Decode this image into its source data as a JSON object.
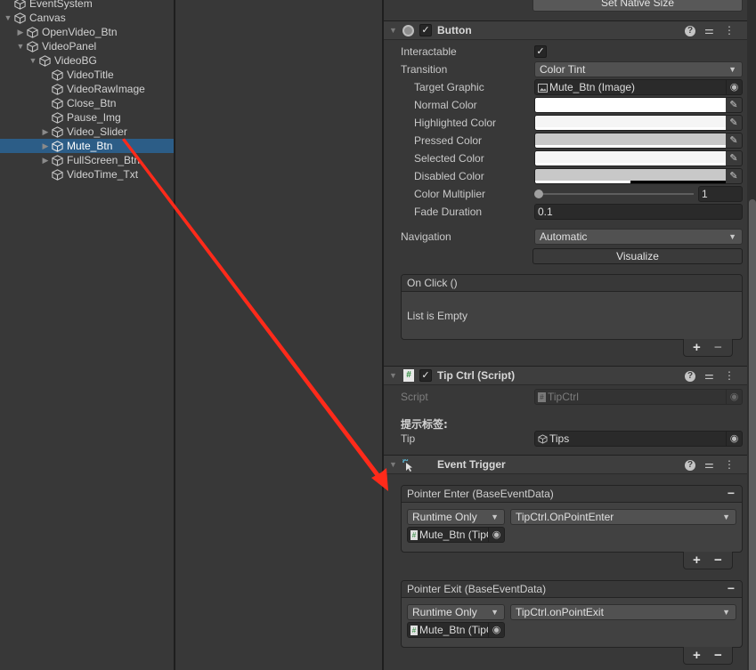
{
  "hierarchy": {
    "items": [
      {
        "label": "EventSystem",
        "depth": 0,
        "foldout": "none",
        "selected": false
      },
      {
        "label": "Canvas",
        "depth": 0,
        "foldout": "expanded",
        "selected": false
      },
      {
        "label": "OpenVideo_Btn",
        "depth": 1,
        "foldout": "collapsed",
        "selected": false
      },
      {
        "label": "VideoPanel",
        "depth": 1,
        "foldout": "expanded",
        "selected": false
      },
      {
        "label": "VideoBG",
        "depth": 2,
        "foldout": "expanded",
        "selected": false
      },
      {
        "label": "VideoTitle",
        "depth": 3,
        "foldout": "none",
        "selected": false
      },
      {
        "label": "VideoRawImage",
        "depth": 3,
        "foldout": "none",
        "selected": false
      },
      {
        "label": "Close_Btn",
        "depth": 3,
        "foldout": "none",
        "selected": false
      },
      {
        "label": "Pause_Img",
        "depth": 3,
        "foldout": "none",
        "selected": false
      },
      {
        "label": "Video_Slider",
        "depth": 3,
        "foldout": "collapsed",
        "selected": false
      },
      {
        "label": "Mute_Btn",
        "depth": 3,
        "foldout": "collapsed",
        "selected": true
      },
      {
        "label": "FullScreen_Btn",
        "depth": 3,
        "foldout": "collapsed",
        "selected": false
      },
      {
        "label": "VideoTime_Txt",
        "depth": 3,
        "foldout": "none",
        "selected": false
      }
    ]
  },
  "inspector": {
    "set_native_size_label": "Set Native Size",
    "button_component": {
      "title": "Button",
      "enabled": true,
      "interactable_label": "Interactable",
      "interactable": true,
      "transition_label": "Transition",
      "transition_value": "Color Tint",
      "target_graphic_label": "Target Graphic",
      "target_graphic_value": "Mute_Btn (Image)",
      "colors": [
        {
          "label": "Normal Color",
          "hex": "#ffffff",
          "alpha": 1.0
        },
        {
          "label": "Highlighted Color",
          "hex": "#f5f5f5",
          "alpha": 1.0
        },
        {
          "label": "Pressed Color",
          "hex": "#c8c8c8",
          "alpha": 1.0
        },
        {
          "label": "Selected Color",
          "hex": "#f5f5f5",
          "alpha": 1.0
        },
        {
          "label": "Disabled Color",
          "hex": "#c8c8c8",
          "alpha": 0.5
        }
      ],
      "color_multiplier_label": "Color Multiplier",
      "color_multiplier_value": "1",
      "color_multiplier_slider_fraction": 0.0,
      "fade_duration_label": "Fade Duration",
      "fade_duration_value": "0.1",
      "navigation_label": "Navigation",
      "navigation_value": "Automatic",
      "visualize_label": "Visualize",
      "on_click_label": "On Click ()",
      "on_click_empty_text": "List is Empty",
      "add_label": "+",
      "remove_label": "−"
    },
    "tipctrl_component": {
      "title": "Tip Ctrl (Script)",
      "enabled": true,
      "script_label": "Script",
      "script_value": "TipCtrl",
      "header_label": "提示标签:",
      "tip_label": "Tip",
      "tip_value": "Tips"
    },
    "event_trigger_component": {
      "title": "Event Trigger",
      "entries": [
        {
          "title": "Pointer Enter (BaseEventData)",
          "call_state": "Runtime Only",
          "function": "TipCtrl.OnPointEnter",
          "target": "Mute_Btn (TipCtrl)"
        },
        {
          "title": "Pointer Exit (BaseEventData)",
          "call_state": "Runtime Only",
          "function": "TipCtrl.onPointExit",
          "target": "Mute_Btn (TipCtrl)"
        }
      ],
      "add_label": "+",
      "remove_label": "−",
      "remove_entry_label": "−"
    },
    "header_icons": {
      "help": "?",
      "presets": "⚌",
      "menu": "⋮"
    }
  },
  "annotation": {
    "type": "red-arrow",
    "color": "#ff2a1a",
    "from": "Mute_Btn",
    "to": "Event Trigger"
  }
}
